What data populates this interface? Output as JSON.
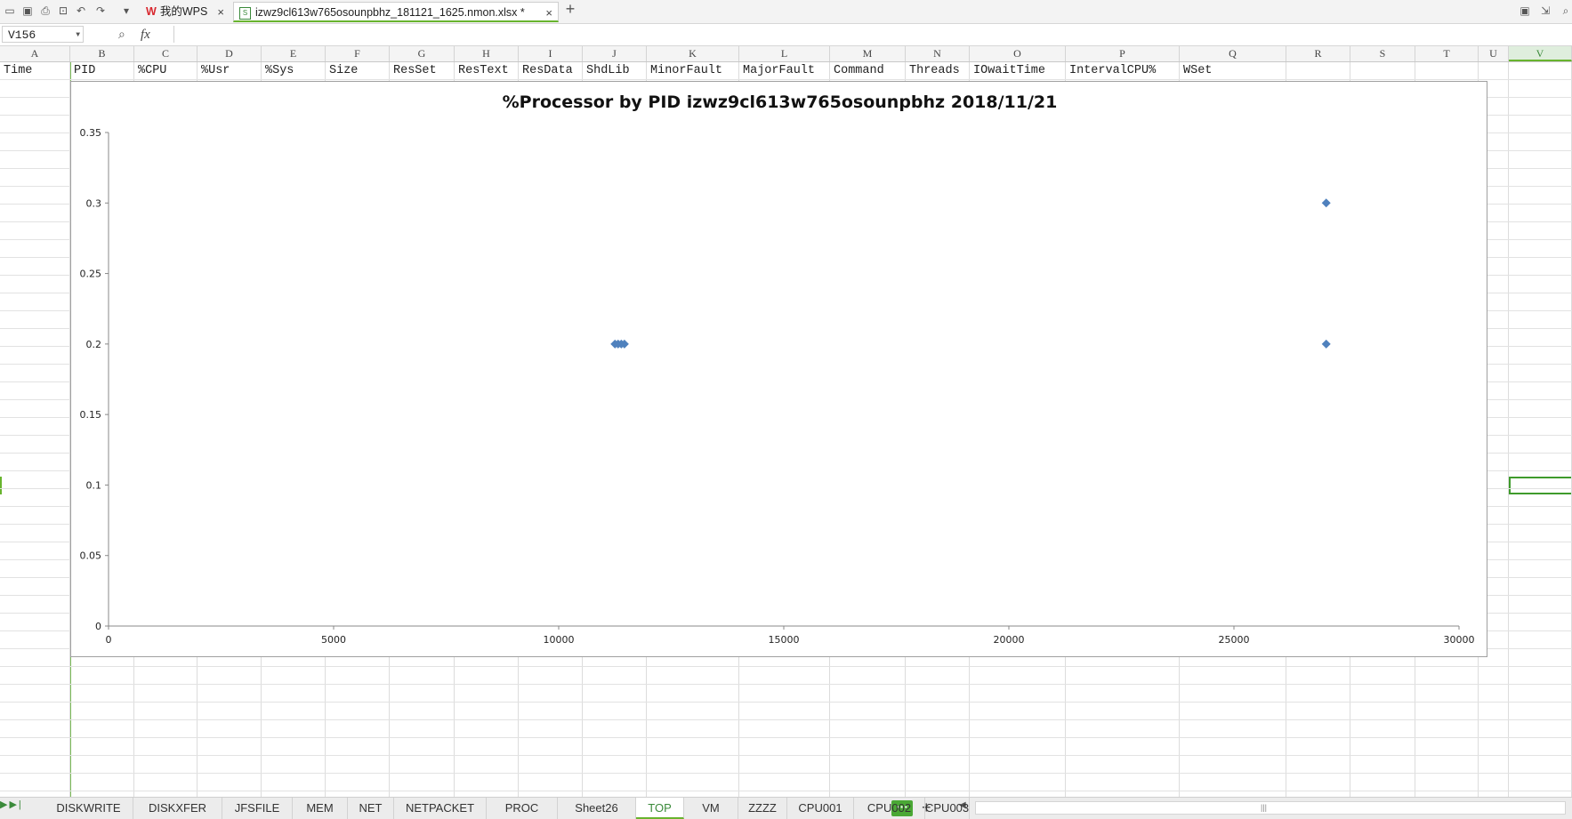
{
  "topbar": {
    "wps_tab_label": "我的WPS",
    "wps_logo": "W",
    "file_tab_label": "izwz9cl613w765osounpbhz_181121_1625.nmon.xlsx *",
    "close_glyph": "×",
    "new_tab_glyph": "+"
  },
  "formula_bar": {
    "name_box": "V156",
    "fx_label": "fx",
    "formula_value": ""
  },
  "columns": [
    "A",
    "B",
    "C",
    "D",
    "E",
    "F",
    "G",
    "H",
    "I",
    "J",
    "K",
    "L",
    "M",
    "N",
    "O",
    "P",
    "Q",
    "R",
    "S",
    "T",
    "U",
    "V"
  ],
  "selected_column": "V",
  "header_row": [
    "Time",
    "PID",
    "%CPU",
    "%Usr",
    "%Sys",
    "Size",
    "ResSet",
    "ResText",
    "ResData",
    "ShdLib",
    "MinorFault",
    "MajorFault",
    "Command",
    "Threads",
    "IOwaitTime",
    "IntervalCPU%",
    "WSet"
  ],
  "chart_data": {
    "type": "scatter",
    "title": "%Processor by PID izwz9cl613w765osounpbhz  2018/11/21",
    "xlabel": "",
    "ylabel": "",
    "xlim": [
      0,
      30000
    ],
    "ylim": [
      0,
      0.35
    ],
    "x_ticks": [
      "0",
      "5000",
      "10000",
      "15000",
      "20000",
      "25000",
      "30000"
    ],
    "y_ticks": [
      "0",
      "0.05",
      "0.1",
      "0.15",
      "0.2",
      "0.25",
      "0.3",
      "0.35"
    ],
    "grid": false,
    "legend": "none",
    "marker": "diamond",
    "color": "#4f81bd",
    "series": [
      {
        "x": [
          11250,
          11320,
          11390,
          11460,
          27050,
          27050
        ],
        "y": [
          0.2,
          0.2,
          0.2,
          0.2,
          0.3,
          0.2
        ]
      }
    ]
  },
  "sheet_tabs": [
    "DISKWRITE",
    "DISKXFER",
    "JFSFILE",
    "MEM",
    "NET",
    "NETPACKET",
    "PROC",
    "Sheet26",
    "TOP",
    "VM",
    "ZZZZ",
    "CPU001",
    "CPU002",
    "CPU003"
  ],
  "active_sheet": "TOP",
  "sheetbar": {
    "more_glyph": "···",
    "add_glyph": "+"
  }
}
